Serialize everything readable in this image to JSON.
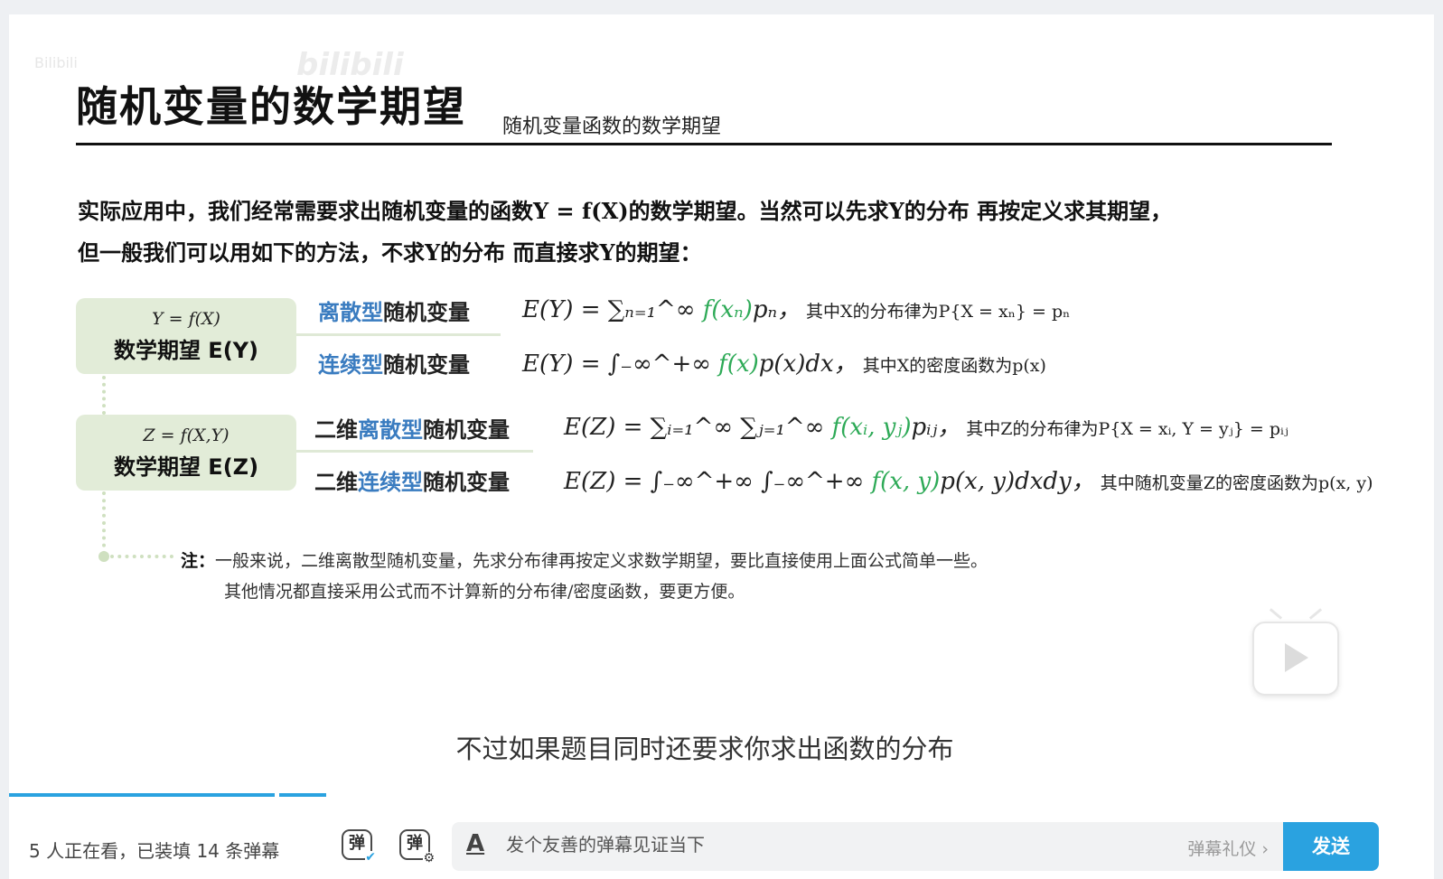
{
  "slide": {
    "watermark": "Bilibili",
    "watermark_logo": "bilibili",
    "title": "随机变量的数学期望",
    "subtitle": "随机变量函数的数学期望",
    "intro_line1": "实际应用中，我们经常需要求出随机变量的函数Y = f(X)的数学期望。当然可以先求Y的分布 再按定义求其期望，",
    "intro_line2": "但一般我们可以用如下的方法，不求Y的分布 而直接求Y的期望：",
    "box1": {
      "formula": "Y = f(X)",
      "label": "数学期望 E(Y)"
    },
    "box2": {
      "formula": "Z = f(X,Y)",
      "label": "数学期望 E(Z)"
    },
    "rows": [
      {
        "prefix": "",
        "blue": "离散型",
        "suffix": "随机变量",
        "lhs": "E(Y) = ∑ₙ₌₁^∞ ",
        "green": "f(xₙ)",
        "rhs": "pₙ，",
        "note": " 其中X的分布律为P{X = xₙ} = pₙ"
      },
      {
        "prefix": "",
        "blue": "连续型",
        "suffix": "随机变量",
        "lhs": "E(Y) = ∫₋∞^+∞ ",
        "green": "f(x)",
        "rhs": "p(x)dx，",
        "note": " 其中X的密度函数为p(x)"
      },
      {
        "prefix": "二维",
        "blue": "离散型",
        "suffix": "随机变量",
        "lhs": "E(Z) = ∑ᵢ₌₁^∞ ∑ⱼ₌₁^∞ ",
        "green": "f(xᵢ, yⱼ)",
        "rhs": "pᵢⱼ，",
        "note": " 其中Z的分布律为P{X = xᵢ, Y = yⱼ} = pᵢⱼ"
      },
      {
        "prefix": "二维",
        "blue": "连续型",
        "suffix": "随机变量",
        "lhs": "E(Z) = ∫₋∞^+∞ ∫₋∞^+∞ ",
        "green": "f(x, y)",
        "rhs": "p(x, y)dxdy，",
        "note": " 其中随机变量Z的密度函数为p(x, y)"
      }
    ],
    "note_label": "注：",
    "note_line1": "一般来说，二维离散型随机变量，先求分布律再按定义求数学期望，要比直接使用上面公式简单一些。",
    "note_line2": "其他情况都直接采用公式而不计算新的分布律/密度函数，要更方便。"
  },
  "subtitle_caption": "不过如果题目同时还要求你求出函数的分布",
  "player": {
    "viewers_text": "5 人正在看，已装填 14 条弹幕",
    "danmaku_icon_char": "弹",
    "danmaku_placeholder": "发个友善的弹幕见证当下",
    "etiquette_label": "弹幕礼仪 ›",
    "send_label": "发送",
    "accent_color": "#2aa2e0"
  }
}
